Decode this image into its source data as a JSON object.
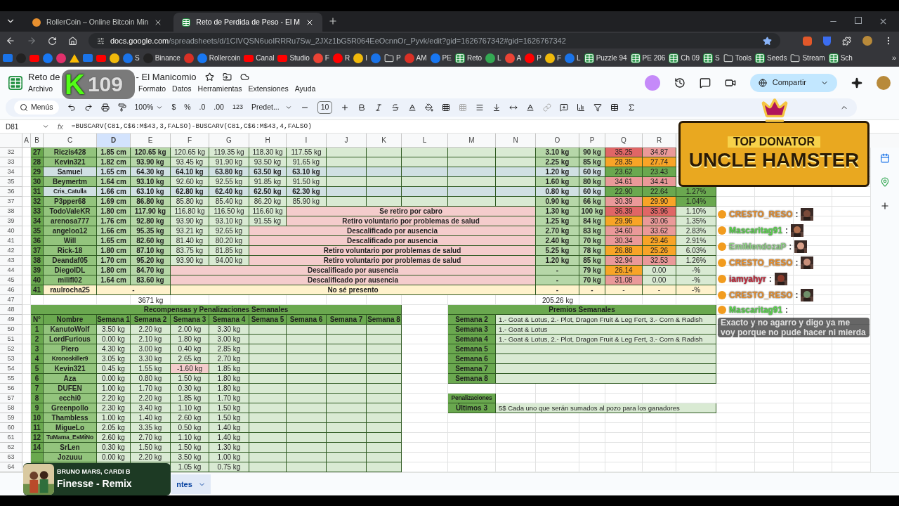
{
  "browser": {
    "tabs": [
      {
        "title": "RollerCoin – Online Bitcoin Min",
        "selected": false,
        "kind": "site"
      },
      {
        "title": "Reto de Perdida de Peso - El M",
        "selected": true,
        "kind": "sheet"
      }
    ],
    "url_host": "docs.google.com",
    "url_path": "/spreadsheets/d/1CIVQSN6uoIRRRu7Sw_2JXz1bG5R064EeOcnnOr_Pyvk/edit?gid=1626767342#gid=1626767342",
    "bookmarks": [
      {
        "kind": "mail"
      },
      {
        "kind": "site"
      },
      {
        "kind": "video"
      },
      {
        "kind": "site"
      },
      {
        "kind": "site"
      },
      {
        "kind": "drive"
      },
      {
        "kind": "mail"
      },
      {
        "kind": "video"
      },
      {
        "kind": "site"
      },
      {
        "label": "S",
        "kind": "site"
      },
      {
        "label": "Binance",
        "kind": "site"
      },
      {
        "kind": "site"
      },
      {
        "label": "Rollercoin",
        "kind": "site"
      },
      {
        "label": "Canal",
        "kind": "video"
      },
      {
        "label": "Studio",
        "kind": "video"
      },
      {
        "label": "F",
        "kind": "site"
      },
      {
        "label": "R",
        "kind": "site"
      },
      {
        "label": "I",
        "kind": "site"
      },
      {
        "kind": "site"
      },
      {
        "label": "P",
        "kind": "folder"
      },
      {
        "label": "AM",
        "kind": "site"
      },
      {
        "label": "PE",
        "kind": "site"
      },
      {
        "label": "Reto",
        "kind": "sheet"
      },
      {
        "label": "L",
        "kind": "site"
      },
      {
        "label": "A",
        "kind": "site"
      },
      {
        "label": "P",
        "kind": "site"
      },
      {
        "label": "F",
        "kind": "site"
      },
      {
        "label": "L",
        "kind": "site"
      },
      {
        "label": "Puzzle 94",
        "kind": "sheet"
      },
      {
        "label": "PE 206",
        "kind": "sheet"
      },
      {
        "label": "Ch 09",
        "kind": "sheet"
      },
      {
        "label": "S",
        "kind": "sheet"
      },
      {
        "label": "Tools",
        "kind": "folder"
      },
      {
        "label": "Seeds",
        "kind": "sheet"
      },
      {
        "label": "Stream",
        "kind": "folder"
      },
      {
        "label": "Sch",
        "kind": "sheet"
      }
    ],
    "bookmarks_more": "»"
  },
  "doc": {
    "title_start": "Reto de",
    "title_end": "- El Manicomio",
    "menus_start": [
      "Archivo"
    ],
    "menus": [
      "Formato",
      "Datos",
      "Herramientas",
      "Extensiones",
      "Ayuda"
    ],
    "share": "Compartir"
  },
  "toolbar": {
    "search": "Menús",
    "zoom": "100%",
    "currency": "$",
    "percent": "%",
    "dec_less": ".0",
    "dec_more": ".00",
    "number_format": "123",
    "font": "Predet...",
    "font_size": "10"
  },
  "formula_bar": {
    "cell": "D81",
    "fx": "fx",
    "formula": "=BUSCARV(C81,C$6:M$43,3,FALSO)-BUSCARV(C81,C$6:M$43,4,FALSO)"
  },
  "columns": [
    {
      "label": "A",
      "selected": false
    },
    {
      "label": "B",
      "selected": false
    },
    {
      "label": "C",
      "selected": false
    },
    {
      "label": "D",
      "selected": true
    },
    {
      "label": "E",
      "selected": false
    },
    {
      "label": "F",
      "selected": false
    },
    {
      "label": "G",
      "selected": false
    },
    {
      "label": "H",
      "selected": false
    },
    {
      "label": "I",
      "selected": false
    },
    {
      "label": "J",
      "selected": false
    },
    {
      "label": "K",
      "selected": false
    },
    {
      "label": "L",
      "selected": false
    },
    {
      "label": "M",
      "selected": false
    },
    {
      "label": "N",
      "selected": false
    },
    {
      "label": "O",
      "selected": false
    },
    {
      "label": "P",
      "selected": false
    },
    {
      "label": "Q",
      "selected": false
    },
    {
      "label": "R",
      "selected": false
    }
  ],
  "row_numbers": [
    "32",
    "33",
    "34",
    "35",
    "36",
    "37",
    "38",
    "39",
    "40",
    "41",
    "42",
    "43",
    "44",
    "45",
    "46",
    "47",
    "48",
    "49",
    "50",
    "51",
    "52",
    "53",
    "54",
    "55",
    "56",
    "57",
    "58",
    "59",
    "60",
    "61",
    "62",
    "63",
    "64"
  ],
  "participants": [
    {
      "num": "27",
      "name": "Riczis428",
      "color": "#93c47d",
      "column_d": "1.85 cm",
      "column_e": "120.65 kg",
      "weeks": [
        "120.65 kg",
        "119.35 kg",
        "118.30 kg",
        "117.55 kg"
      ],
      "column_o": "3.10 kg",
      "column_p": "90 kg",
      "column_q": {
        "text": "35.25",
        "color": "#e06666"
      },
      "column_r": {
        "text": "34.87",
        "color": "#ea9999"
      }
    },
    {
      "num": "28",
      "name": "Kevin321",
      "color": "#93c47d",
      "column_d": "1.82 cm",
      "column_e": "93.90 kg",
      "weeks": [
        "93.45 kg",
        "91.90 kg",
        "93.50 kg",
        "91.65 kg"
      ],
      "column_o": "2.25 kg",
      "column_p": "85 kg",
      "column_q": {
        "text": "28.35",
        "color": "#f8a427"
      },
      "column_r": {
        "text": "27.74",
        "color": "#f8a427"
      }
    },
    {
      "num": "29",
      "name": "Samuel",
      "color": "#d0e0e3",
      "column_d": "1.65 cm",
      "column_e": "64.30 kg",
      "weeks": [
        "64.10 kg",
        "63.80 kg",
        "63.50 kg",
        "63.10 kg"
      ],
      "column_o": "1.20 kg",
      "column_p": "60 kg",
      "column_q": {
        "text": "23.62",
        "color": "#6aa84f"
      },
      "column_r": {
        "text": "23.43",
        "color": "#6aa84f"
      }
    },
    {
      "num": "30",
      "name": "Beymertm",
      "color": "#93c47d",
      "column_d": "1.64 cm",
      "column_e": "93.10 kg",
      "weeks": [
        "92.60 kg",
        "92.55 kg",
        "91.85 kg",
        "91.50 kg"
      ],
      "column_o": "1.60 kg",
      "column_p": "80 kg",
      "column_q": {
        "text": "34.61",
        "color": "#ea9999"
      },
      "column_r": {
        "text": "34.41",
        "color": "#ea9999"
      }
    },
    {
      "num": "31",
      "name": "Cris_Catulla",
      "color": "#d0e0e3",
      "column_d": "1.66 cm",
      "column_e": "63.10 kg",
      "weeks": [
        "62.80 kg",
        "62.40 kg",
        "62.50 kg",
        "62.30 kg"
      ],
      "column_o": "0.80 kg",
      "column_p": "60 kg",
      "column_q": {
        "text": "22.90",
        "color": "#6aa84f"
      },
      "column_r": {
        "text": "22.64",
        "color": "#6aa84f"
      },
      "column_s": {
        "text": "1.27%",
        "color": "#6aa84f"
      }
    },
    {
      "num": "32",
      "name": "P3pper68",
      "color": "#93c47d",
      "column_d": "1.69 cm",
      "column_e": "86.80 kg",
      "weeks": [
        "85.80 kg",
        "85.40 kg",
        "86.20 kg",
        "85.90 kg"
      ],
      "column_o": "0.90 kg",
      "column_p": "66 kg",
      "column_q": {
        "text": "30.39",
        "color": "#ea9999"
      },
      "column_r": {
        "text": "29.90",
        "color": "#f8a427"
      },
      "column_s": {
        "text": "1.04%",
        "color": "#6aa84f"
      }
    },
    {
      "num": "33",
      "name": "TodoValeKR",
      "color": "#93c47d",
      "column_d": "1.80 cm",
      "column_e": "117.90 kg",
      "weeks": [
        "116.80 kg",
        "116.50 kg",
        "116.60 kg"
      ],
      "status": "Se retiro por cabro",
      "column_o": "1.30 kg",
      "column_p": "100 kg",
      "column_q": {
        "text": "36.39",
        "color": "#e06666"
      },
      "column_r": {
        "text": "35.96",
        "color": "#e06666"
      },
      "column_s": {
        "text": "1.10%",
        "color": "#d9ead3"
      }
    },
    {
      "num": "34",
      "name": "arenosa777",
      "color": "#93c47d",
      "column_d": "1.76 cm",
      "column_e": "92.80 kg",
      "weeks": [
        "93.90 kg",
        "93.10 kg",
        "91.55 kg"
      ],
      "status": "Retiro voluntario por problemas de salud",
      "column_o": "1.25 kg",
      "column_p": "84 kg",
      "column_q": {
        "text": "29.96",
        "color": "#f8a427"
      },
      "column_r": {
        "text": "30.06",
        "color": "#ea9999"
      },
      "column_s": {
        "text": "1.35%",
        "color": "#d9ead3"
      }
    },
    {
      "num": "35",
      "name": "angeloo12",
      "color": "#93c47d",
      "column_d": "1.66 cm",
      "column_e": "95.35 kg",
      "weeks": [
        "93.21 kg",
        "92.65 kg"
      ],
      "status": "Descalificado por ausencia",
      "column_o": "2.70 kg",
      "column_p": "83 kg",
      "column_q": {
        "text": "34.60",
        "color": "#ea9999"
      },
      "column_r": {
        "text": "33.62",
        "color": "#ea9999"
      },
      "column_s": {
        "text": "2.83%",
        "color": "#d9ead3"
      }
    },
    {
      "num": "36",
      "name": "Will",
      "color": "#93c47d",
      "column_d": "1.65 cm",
      "column_e": "82.60 kg",
      "weeks": [
        "81.40 kg",
        "80.20 kg"
      ],
      "status": "Descalificado por ausencia",
      "column_o": "2.40 kg",
      "column_p": "70 kg",
      "column_q": {
        "text": "30.34",
        "color": "#ea9999"
      },
      "column_r": {
        "text": "29.46",
        "color": "#f8a427"
      },
      "column_s": {
        "text": "2.91%",
        "color": "#d9ead3"
      }
    },
    {
      "num": "37",
      "name": "Rick-18",
      "color": "#93c47d",
      "column_d": "1.80 cm",
      "column_e": "87.10 kg",
      "weeks": [
        "83.75 kg",
        "81.85 kg"
      ],
      "status": "Retiro voluntario por problemas de salud",
      "column_o": "5.25 kg",
      "column_p": "78 kg",
      "column_q": {
        "text": "26.88",
        "color": "#f8a427"
      },
      "column_r": {
        "text": "25.26",
        "color": "#f8a427"
      },
      "column_s": {
        "text": "6.03%",
        "color": "#d9ead3"
      }
    },
    {
      "num": "38",
      "name": "Deandaf05",
      "color": "#93c47d",
      "column_d": "1.70 cm",
      "column_e": "95.20 kg",
      "weeks": [
        "93.90 kg",
        "94.00 kg"
      ],
      "status": "Retiro voluntario por problemas de salud",
      "column_o": "1.20 kg",
      "column_p": "85 kg",
      "column_q": {
        "text": "32.94",
        "color": "#ea9999"
      },
      "column_r": {
        "text": "32.53",
        "color": "#ea9999"
      },
      "column_s": {
        "text": "1.26%",
        "color": "#d9ead3"
      }
    },
    {
      "num": "39",
      "name": "DiegoIDL",
      "color": "#93c47d",
      "column_d": "1.80 cm",
      "column_e": "84.70 kg",
      "status": "Descalificado por ausencia",
      "column_o": "-",
      "column_p": "79 kg",
      "column_q": {
        "text": "26.14",
        "color": "#f8a427"
      },
      "column_r": {
        "text": "0.00",
        "color": "#d9ead3"
      },
      "column_s": {
        "text": "-%",
        "color": "#d9ead3"
      }
    },
    {
      "num": "40",
      "name": "milifl02",
      "color": "#93c47d",
      "column_d": "1.64 cm",
      "column_e": "83.60 kg",
      "status": "Descalificado por ausencia",
      "column_o": "-",
      "column_p": "70 kg",
      "column_q": {
        "text": "31.08",
        "color": "#ea9999"
      },
      "column_r": {
        "text": "0.00",
        "color": "#d9ead3"
      },
      "column_s": {
        "text": "-%",
        "color": "#d9ead3"
      }
    },
    {
      "num": "41",
      "name": "raulrocha25",
      "color": "#fff2cc",
      "column_d": "-",
      "status": "No sé presento",
      "column_o": "-",
      "column_p": "-",
      "column_q": {
        "text": "-",
        "color": "#fff2cc"
      },
      "column_r": {
        "text": "-",
        "color": "#fff2cc"
      },
      "column_s": {
        "text": "-%",
        "color": "#fff2cc"
      }
    }
  ],
  "totals": {
    "column_e": "3671 kg",
    "column_o": "205.26 kg"
  },
  "rewards": {
    "title": "Recompensas y Penalizaciones Semanales",
    "headers": [
      "N°",
      "Nombre",
      "Semana 1",
      "Semana 2",
      "Semana 3",
      "Semana 4",
      "Semana 5",
      "Semana 6",
      "Semana 7",
      "Semana 8"
    ],
    "rows": [
      {
        "num": "1",
        "name": "KanutoWolf",
        "weeks": [
          {
            "text": "3.50 kg",
            "penalty": false
          },
          {
            "text": "2.20 kg",
            "penalty": false
          },
          {
            "text": "2.00 kg",
            "penalty": false
          },
          {
            "text": "3.30 kg",
            "penalty": false
          }
        ]
      },
      {
        "num": "2",
        "name": "LordFurious",
        "weeks": [
          {
            "text": "0.00 kg",
            "penalty": false
          },
          {
            "text": "2.10 kg",
            "penalty": false
          },
          {
            "text": "1.80 kg",
            "penalty": false
          },
          {
            "text": "3.00 kg",
            "penalty": false
          }
        ]
      },
      {
        "num": "3",
        "name": "Piero",
        "weeks": [
          {
            "text": "4.30 kg",
            "penalty": false
          },
          {
            "text": "3.00 kg",
            "penalty": false
          },
          {
            "text": "0.40 kg",
            "penalty": false
          },
          {
            "text": "2.85 kg",
            "penalty": false
          }
        ]
      },
      {
        "num": "4",
        "name": "Kronoskiller9",
        "weeks": [
          {
            "text": "3.05 kg",
            "penalty": false
          },
          {
            "text": "3.30 kg",
            "penalty": false
          },
          {
            "text": "2.65 kg",
            "penalty": false
          },
          {
            "text": "2.70 kg",
            "penalty": false
          }
        ]
      },
      {
        "num": "5",
        "name": "Kevin321",
        "weeks": [
          {
            "text": "0.45 kg",
            "penalty": false
          },
          {
            "text": "1.55 kg",
            "penalty": false
          },
          {
            "text": "-1.60 kg",
            "penalty": true
          },
          {
            "text": "1.85 kg",
            "penalty": false
          }
        ]
      },
      {
        "num": "6",
        "name": "Aza",
        "weeks": [
          {
            "text": "0.00 kg",
            "penalty": false
          },
          {
            "text": "0.80 kg",
            "penalty": false
          },
          {
            "text": "1.50 kg",
            "penalty": false
          },
          {
            "text": "1.80 kg",
            "penalty": false
          }
        ]
      },
      {
        "num": "7",
        "name": "DUFEN",
        "weeks": [
          {
            "text": "1.00 kg",
            "penalty": false
          },
          {
            "text": "1.70 kg",
            "penalty": false
          },
          {
            "text": "0.30 kg",
            "penalty": false
          },
          {
            "text": "1.80 kg",
            "penalty": false
          }
        ]
      },
      {
        "num": "8",
        "name": "ecchi0",
        "weeks": [
          {
            "text": "2.20 kg",
            "penalty": false
          },
          {
            "text": "2.20 kg",
            "penalty": false
          },
          {
            "text": "1.85 kg",
            "penalty": false
          },
          {
            "text": "1.70 kg",
            "penalty": false
          }
        ]
      },
      {
        "num": "9",
        "name": "Greenpollo",
        "weeks": [
          {
            "text": "2.30 kg",
            "penalty": false
          },
          {
            "text": "3.40 kg",
            "penalty": false
          },
          {
            "text": "1.10 kg",
            "penalty": false
          },
          {
            "text": "1.50 kg",
            "penalty": false
          }
        ]
      },
      {
        "num": "10",
        "name": "Thambless",
        "weeks": [
          {
            "text": "1.00 kg",
            "penalty": false
          },
          {
            "text": "1.40 kg",
            "penalty": false
          },
          {
            "text": "2.60 kg",
            "penalty": false
          },
          {
            "text": "1.50 kg",
            "penalty": false
          }
        ]
      },
      {
        "num": "11",
        "name": "MigueLo",
        "weeks": [
          {
            "text": "2.05 kg",
            "penalty": false
          },
          {
            "text": "3.35 kg",
            "penalty": false
          },
          {
            "text": "0.50 kg",
            "penalty": false
          },
          {
            "text": "1.40 kg",
            "penalty": false
          }
        ]
      },
      {
        "num": "12",
        "name": "TuMama_EsMiNo",
        "weeks": [
          {
            "text": "2.60 kg",
            "penalty": false
          },
          {
            "text": "2.70 kg",
            "penalty": false
          },
          {
            "text": "1.10 kg",
            "penalty": false
          },
          {
            "text": "1.40 kg",
            "penalty": false
          }
        ]
      },
      {
        "num": "14",
        "name": "SrLen",
        "weeks": [
          {
            "text": "0.30 kg",
            "penalty": false
          },
          {
            "text": "1.50 kg",
            "penalty": false
          },
          {
            "text": "1.50 kg",
            "penalty": false
          },
          {
            "text": "1.30 kg",
            "penalty": false
          }
        ]
      },
      {
        "name": "Jozuuu",
        "weeks": [
          {
            "text": "0.00 kg",
            "penalty": false
          },
          {
            "text": "2.20 kg",
            "penalty": false
          },
          {
            "text": "3.50 kg",
            "penalty": false
          },
          {
            "text": "1.00 kg",
            "penalty": false
          }
        ]
      },
      {
        "weeks": [
          {
            "penalty": false
          },
          {
            "penalty": false
          },
          {
            "text": "1.05 kg",
            "penalty": false
          },
          {
            "text": "0.75 kg",
            "penalty": false
          }
        ]
      }
    ]
  },
  "prizes": {
    "title": "Premios Semanales",
    "rows": [
      {
        "week": "Semana 2",
        "prize": "1.- Goat & Lotus, 2.- Plot, Dragon Fruit & Leg Fert, 3.- Corn & Radish"
      },
      {
        "week": "Semana 3",
        "prize": "1.- Goat & Lotus"
      },
      {
        "week": "Semana 4",
        "prize": "1.- Goat & Lotus, 2.- Plot, Dragon Fruit & Leg Fert, 3.- Corn & Radish"
      },
      {
        "week": "Semana 5"
      },
      {
        "week": "Semana 6"
      },
      {
        "week": "Semana 7"
      },
      {
        "week": "Semana 8"
      }
    ]
  },
  "penalties": {
    "title": "Penalizaciones",
    "rows": [
      {
        "label": "Últimos 3",
        "text": "5$ Cada uno que serán sumados al pozo para los ganadores"
      }
    ]
  },
  "sheet_tab": {
    "label": "ntes",
    "selected": true
  },
  "overlays": {
    "viewer_badge": {
      "logo": "K",
      "count": "109"
    },
    "donator_banner": {
      "line_1": "TOP DONATOR",
      "line_2": "UNCLE HAMSTER"
    },
    "chat": [
      {
        "user": "CRESTO_RESO",
        "sep": ":",
        "color": "#e8902f",
        "kind": "emote"
      },
      {
        "user": "Mascaritag91",
        "sep": ":",
        "color": "#58d64b",
        "kind": "emote"
      },
      {
        "user": "EmiMendozaP",
        "sep": ":",
        "color": "#8fcf86",
        "kind": "emote"
      },
      {
        "user": "CRESTO_RESO",
        "sep": ":",
        "color": "#e8902f",
        "kind": "emote"
      },
      {
        "user": "iamyahyr",
        "sep": ":",
        "color": "#c8283c",
        "kind": "emote"
      },
      {
        "user": "CRESTO_RESO",
        "sep": ":",
        "color": "#e8902f",
        "kind": "emote"
      },
      {
        "user": "Mascaritag91",
        "sep": ":",
        "color": "#58d64b",
        "kind": "text",
        "text": "Exacto y no agarro y digo ya me voy porque no pude hacer ni mierda"
      }
    ],
    "now_playing": {
      "artist": "BRUNO MARS, CARDI B",
      "title": "Finesse - Remix"
    }
  }
}
